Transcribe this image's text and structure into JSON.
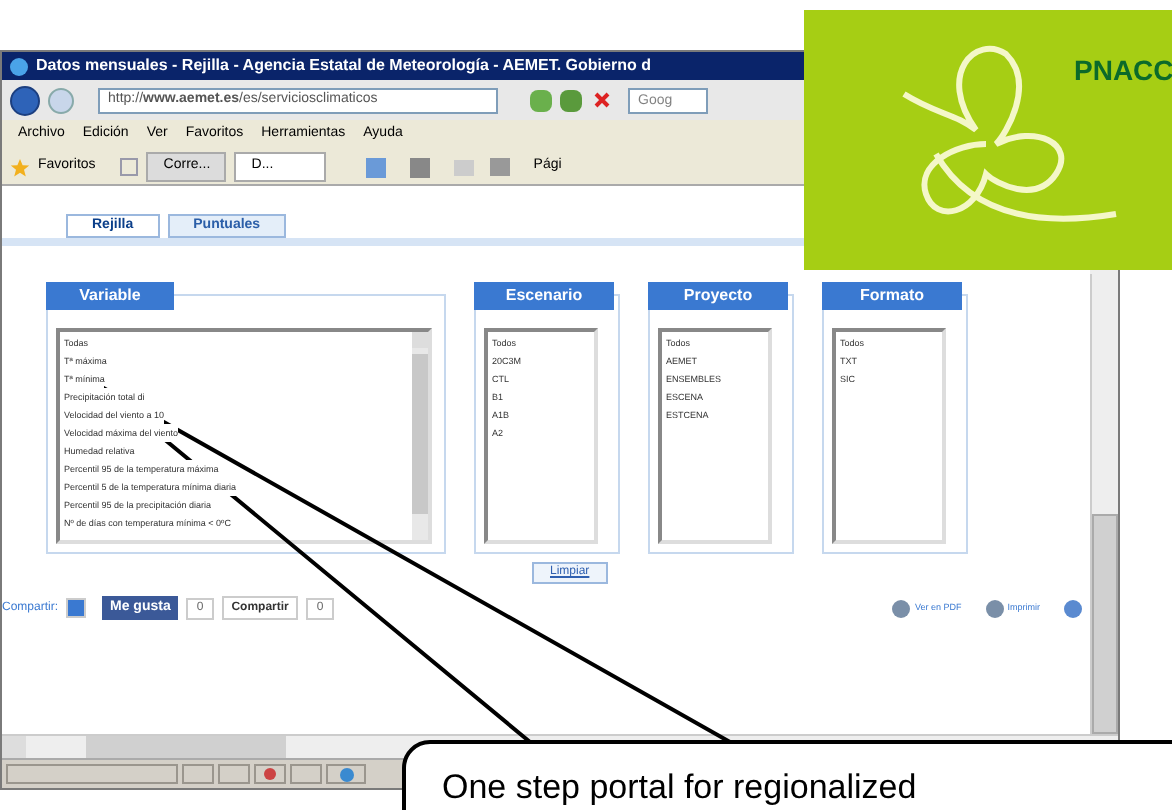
{
  "browser": {
    "title": "Datos mensuales - Rejilla - Agencia Estatal de Meteorología - AEMET. Gobierno d",
    "address": "http://**www.aemet.es**/es/serviciosclimaticos",
    "search": {
      "placeholder": "Goog"
    },
    "menu": [
      "Archivo",
      "Edición",
      "Ver",
      "Favoritos",
      "Herramientas",
      "Ayuda"
    ],
    "favorites_label": "Favoritos",
    "tabs": [
      {
        "label": "Corre...",
        "selected": false
      },
      {
        "label": "D...",
        "selected": true
      }
    ],
    "page_label": "Pági"
  },
  "page_tabs": [
    {
      "label": "Rejilla",
      "selected": true
    },
    {
      "label": "Puntuales",
      "selected": false
    }
  ],
  "panels": [
    {
      "title": "Variable",
      "wide": true,
      "options": [
        "Todas",
        "Tª máxima",
        "Tª mínima",
        "Precipitación total di",
        "Velocidad del viento a 10",
        "Velocidad máxima del viento",
        "Humedad relativa",
        "Percentil 95 de la temperatura máxima",
        "Percentil 5 de la temperatura mínima diaria",
        "Percentil 95 de la precipitación diaria",
        "Nº de días con temperatura mínima < 0ºC"
      ]
    },
    {
      "title": "Escenario",
      "wide": false,
      "options": [
        "Todos",
        "20C3M",
        "CTL",
        "B1",
        "A1B",
        "A2"
      ]
    },
    {
      "title": "Proyecto",
      "wide": false,
      "options": [
        "Todos",
        "AEMET",
        "ENSEMBLES",
        "ESCENA",
        "ESTCENA"
      ]
    },
    {
      "title": "Formato",
      "wide": false,
      "options": [
        "Todos",
        "TXT",
        "SIC"
      ]
    }
  ],
  "clear_button": "Limpiar",
  "share": {
    "label": "Compartir:",
    "like": "Me gusta",
    "like_count": "0",
    "plus": "Compartir",
    "plus_count": "0"
  },
  "actions": [
    "Ver en PDF",
    "Imprimir"
  ],
  "logo": {
    "text": "PNACC"
  },
  "callout": {
    "text": "One step portal for regionalized"
  }
}
